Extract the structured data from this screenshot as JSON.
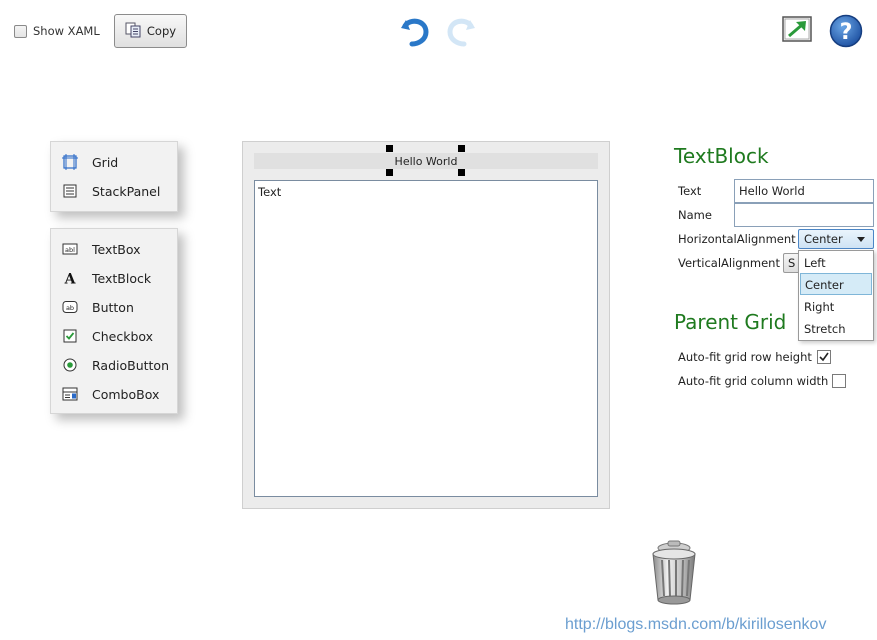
{
  "toolbar": {
    "show_xaml_label": "Show XAML",
    "copy_label": "Copy",
    "icons": [
      "undo-icon",
      "redo-icon",
      "fullscreen-icon",
      "help-icon"
    ]
  },
  "toolbox": {
    "layout_items": [
      {
        "label": "Grid",
        "icon": "grid-icon"
      },
      {
        "label": "StackPanel",
        "icon": "stackpanel-icon"
      }
    ],
    "control_items": [
      {
        "label": "TextBox",
        "icon": "textbox-icon"
      },
      {
        "label": "TextBlock",
        "icon": "textblock-icon"
      },
      {
        "label": "Button",
        "icon": "button-icon"
      },
      {
        "label": "Checkbox",
        "icon": "checkbox-icon"
      },
      {
        "label": "RadioButton",
        "icon": "radiobutton-icon"
      },
      {
        "label": "ComboBox",
        "icon": "combobox-icon"
      }
    ]
  },
  "designer": {
    "selected_text": "Hello World",
    "inner_text": "Text"
  },
  "properties": {
    "heading": "TextBlock",
    "text_label": "Text",
    "text_value": "Hello World",
    "name_label": "Name",
    "name_value": "",
    "halign_label": "HorizontalAlignment",
    "halign_value": "Center",
    "valign_label": "VerticalAlignment",
    "valign_value": "S",
    "halign_options": [
      "Left",
      "Center",
      "Right",
      "Stretch"
    ],
    "halign_selected": "Center"
  },
  "parent_grid": {
    "heading": "Parent Grid",
    "autofit_row_label": "Auto-fit grid row height",
    "autofit_row_checked": true,
    "autofit_col_label": "Auto-fit grid column width",
    "autofit_col_checked": false
  },
  "footer": {
    "url": "http://blogs.msdn.com/b/kirillosenkov",
    "trash_icon": "trash-icon"
  },
  "colors": {
    "heading_green": "#1f7a1f",
    "accent_blue": "#2a78c8",
    "link_blue": "#6b9ed0"
  }
}
